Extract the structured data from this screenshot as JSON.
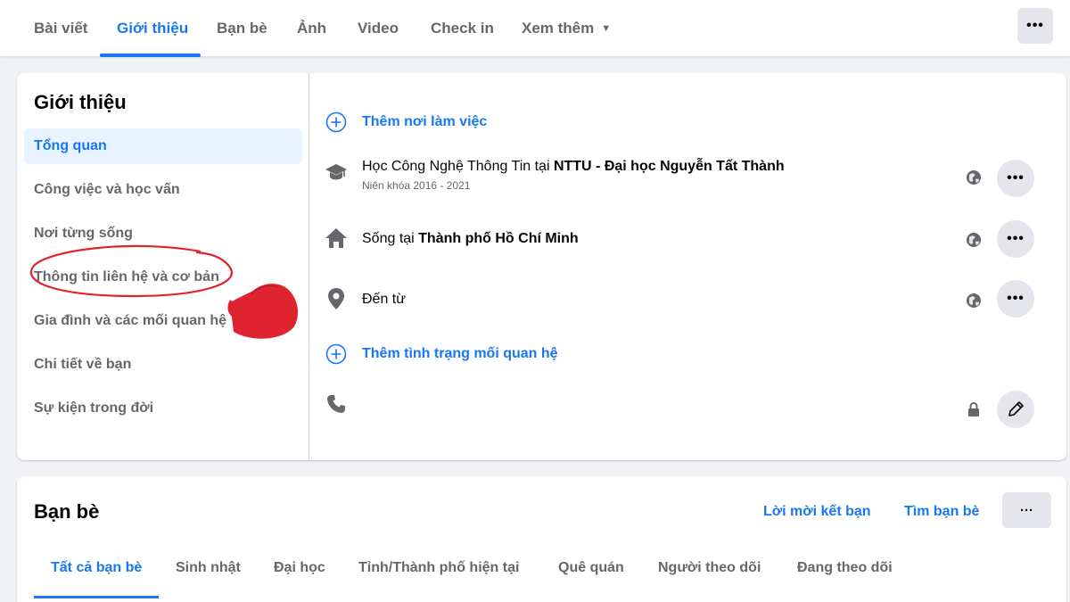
{
  "top_tabs": [
    "Bài viết",
    "Giới thiệu",
    "Bạn bè",
    "Ảnh",
    "Video",
    "Check in",
    "Xem thêm"
  ],
  "top_active": "Giới thiệu",
  "top_more": "•••",
  "about": {
    "title": "Giới thiệu",
    "sidebar": [
      "Tổng quan",
      "Công việc và học vấn",
      "Nơi từng sống",
      "Thông tin liên hệ và cơ bản",
      "Gia đình và các mối quan hệ",
      "Chi tiết về bạn",
      "Sự kiện trong đời"
    ],
    "add_work": "Thêm nơi làm việc",
    "education": {
      "prefix": "Học Công Nghệ Thông Tin tại ",
      "school": "NTTU - Đại học Nguyễn Tất Thành",
      "sub": "Niên khóa 2016 - 2021"
    },
    "lives": {
      "prefix": "Sống tại ",
      "city": "Thành phố Hồ Chí Minh"
    },
    "from": "Đến từ",
    "add_relationship": "Thêm tình trạng mối quan hệ",
    "more_label": "•••"
  },
  "friends": {
    "title": "Bạn bè",
    "requests": "Lời mời kết bạn",
    "find": "Tìm bạn bè",
    "more": "···",
    "tabs": [
      "Tất cả bạn bè",
      "Sinh nhật",
      "Đại học",
      "Tỉnh/Thành phố hiện tại",
      "Quê quán",
      "Người theo dõi",
      "Đang theo dõi"
    ]
  },
  "colors": {
    "accent": "#1877f2",
    "annotation": "#e0242f"
  },
  "icons": [
    "plus-circle-icon",
    "graduation-cap-icon",
    "home-icon",
    "location-pin-icon",
    "phone-icon",
    "globe-icon",
    "lock-icon",
    "pencil-icon",
    "pointing-hand-icon"
  ]
}
